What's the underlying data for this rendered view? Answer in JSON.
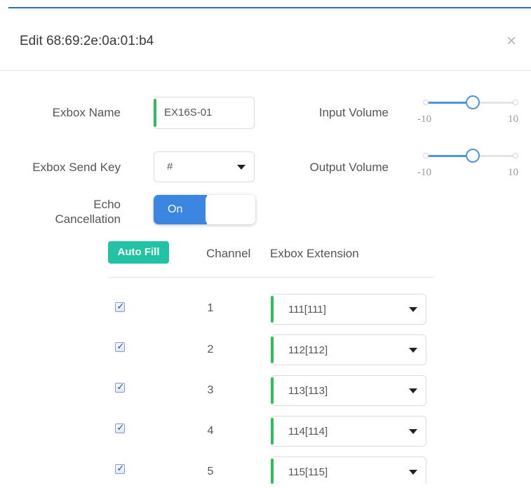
{
  "dialog": {
    "title": "Edit  68:69:2e:0a:01:b4",
    "close_glyph": "×"
  },
  "form": {
    "exbox_name_label": "Exbox Name",
    "exbox_name_value": "EX16S-01",
    "send_key_label": "Exbox Send Key",
    "send_key_value": "#",
    "echo_label_line1": "Echo",
    "echo_label_line2": "Cancellation",
    "echo_state": "On",
    "input_volume_label": "Input Volume",
    "output_volume_label": "Output Volume",
    "input_volume": {
      "min": "-10",
      "max": "10",
      "value": -2.6
    },
    "output_volume": {
      "min": "-10",
      "max": "10",
      "value": -2.6
    }
  },
  "table": {
    "autofill_label": "Auto Fill",
    "col_channel": "Channel",
    "col_extension": "Exbox Extension",
    "rows": [
      {
        "checked": true,
        "channel": "1",
        "extension": "111[111]"
      },
      {
        "checked": true,
        "channel": "2",
        "extension": "112[112]"
      },
      {
        "checked": true,
        "channel": "3",
        "extension": "113[113]"
      },
      {
        "checked": true,
        "channel": "4",
        "extension": "114[114]"
      },
      {
        "checked": true,
        "channel": "5",
        "extension": "115[115]"
      }
    ]
  },
  "colors": {
    "accent_blue": "#3a86e0",
    "accent_green": "#2ebd5a",
    "autofill_teal": "#22c2a4"
  },
  "icons": {
    "close": "close-icon",
    "dropdown": "caret-down-icon",
    "checkbox": "checkbox-checked-icon"
  }
}
